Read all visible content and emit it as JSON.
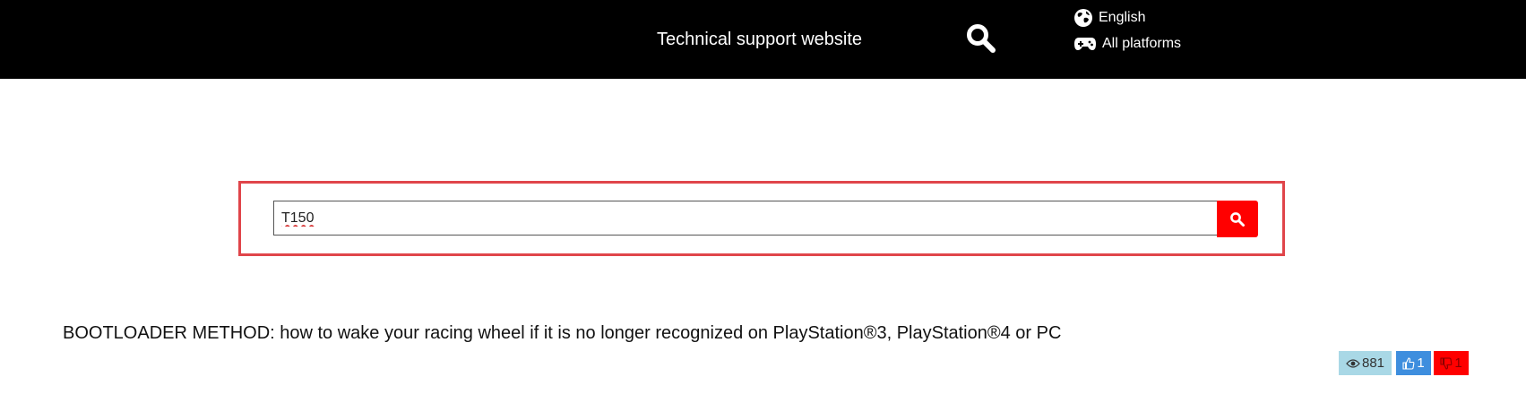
{
  "header": {
    "title": "Technical support website",
    "search_icon": "search-icon",
    "language": {
      "icon": "globe-icon",
      "label": "English"
    },
    "platform": {
      "icon": "gamepad-icon",
      "label": "All platforms"
    },
    "background": "#000000"
  },
  "search": {
    "value": "T150",
    "placeholder": "",
    "submit_icon": "search-icon",
    "frame_color": "#e0454a",
    "button_color": "#ff0000"
  },
  "results": [
    {
      "title": "BOOTLOADER METHOD: how to wake your racing wheel if it is no longer recognized on PlayStation®3, PlayStation®4 or PC",
      "views": "881",
      "likes": "1",
      "dislikes": "1",
      "views_icon": "eye-icon",
      "likes_icon": "thumbs-up-icon",
      "dislikes_icon": "thumbs-down-icon"
    }
  ]
}
